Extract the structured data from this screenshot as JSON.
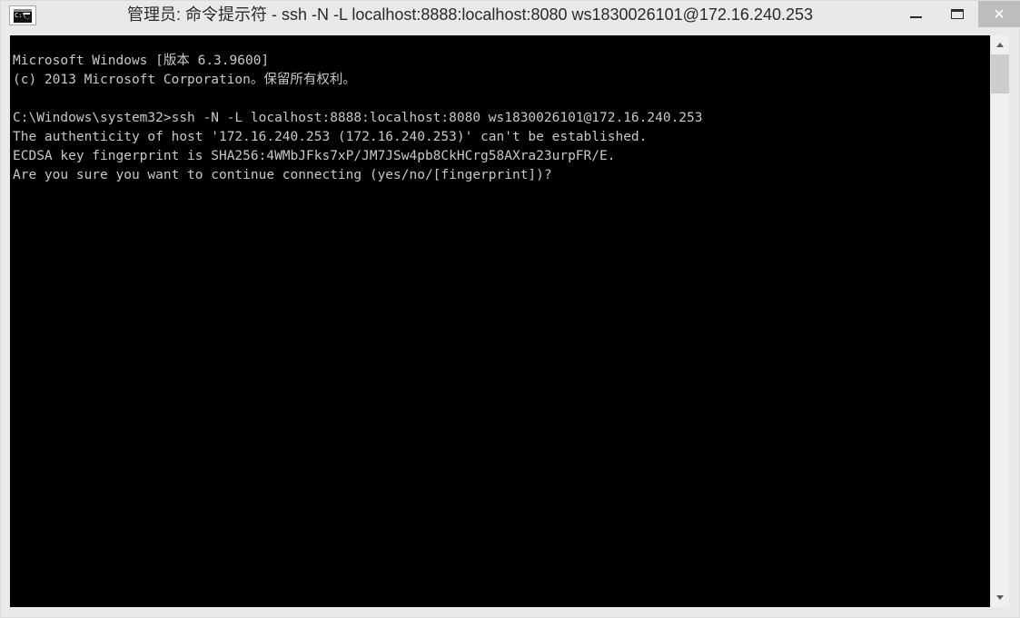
{
  "window": {
    "title": "管理员: 命令提示符 - ssh  -N -L localhost:8888:localhost:8080 ws1830026101@172.16.240.253",
    "icon_name": "cmd-console-icon",
    "colors": {
      "chrome_bg": "#e9e9e9",
      "console_bg": "#000000",
      "console_fg": "#c8c8c8",
      "close_button_bg": "#bdbdbd",
      "scrollbar_track": "#f0f0f0",
      "scrollbar_thumb": "#cdcdcd"
    }
  },
  "controls": {
    "minimize_label": "—",
    "maximize_label": "❐",
    "close_label": "✕"
  },
  "scrollbar": {
    "up_label": "▲",
    "down_label": "▼"
  },
  "console": {
    "lines": [
      "Microsoft Windows [版本 6.3.9600]",
      "(c) 2013 Microsoft Corporation。保留所有权利。",
      "",
      "C:\\Windows\\system32>ssh -N -L localhost:8888:localhost:8080 ws1830026101@172.16.240.253",
      "The authenticity of host '172.16.240.253 (172.16.240.253)' can't be established.",
      "ECDSA key fingerprint is SHA256:4WMbJFks7xP/JM7JSw4pb8CkHCrg58AXra23urpFR/E.",
      "Are you sure you want to continue connecting (yes/no/[fingerprint])?"
    ],
    "text": "Microsoft Windows [版本 6.3.9600]\n(c) 2013 Microsoft Corporation。保留所有权利。\n\nC:\\Windows\\system32>ssh -N -L localhost:8888:localhost:8080 ws1830026101@172.16.240.253\nThe authenticity of host '172.16.240.253 (172.16.240.253)' can't be established.\nECDSA key fingerprint is SHA256:4WMbJFks7xP/JM7JSw4pb8CkHCrg58AXra23urpFR/E.\nAre you sure you want to continue connecting (yes/no/[fingerprint])?"
  }
}
